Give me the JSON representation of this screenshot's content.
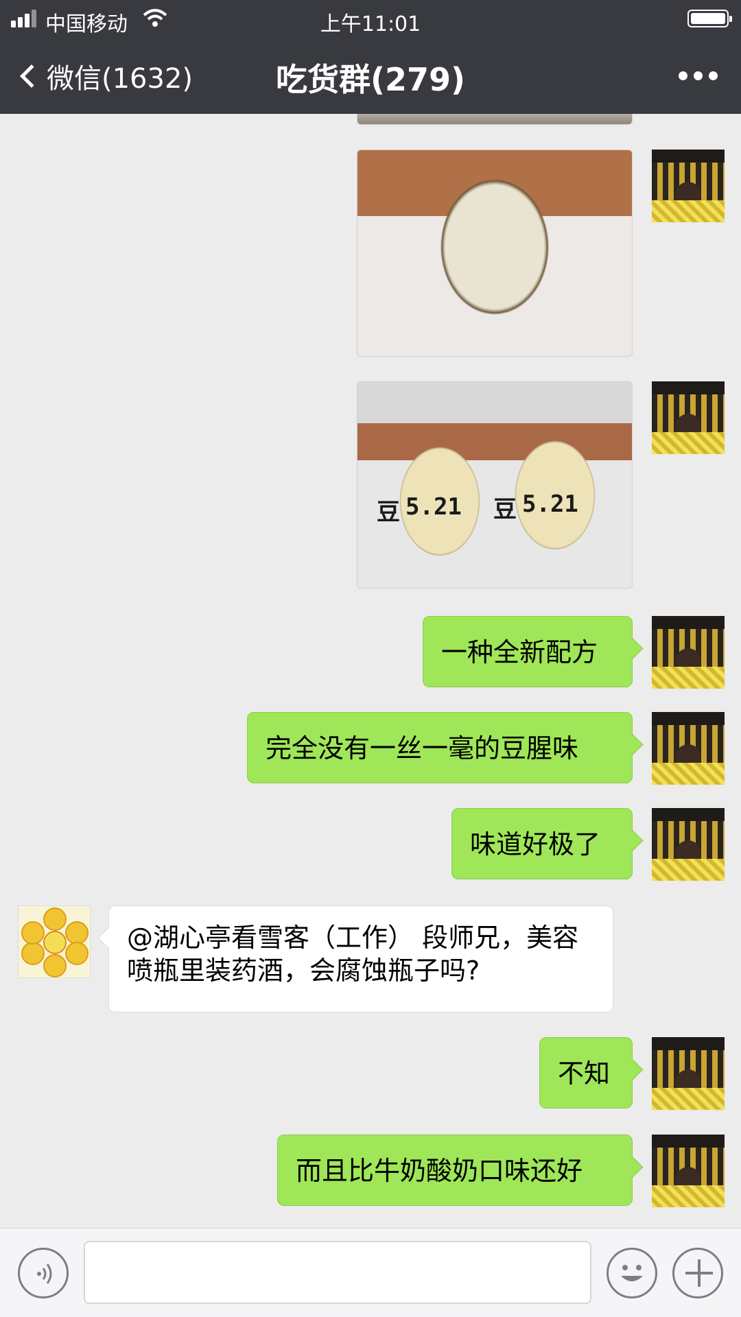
{
  "status_bar": {
    "carrier": "中国移动",
    "time": "上午11:01"
  },
  "nav": {
    "back_label": "微信(1632)",
    "title": "吃货群(279)"
  },
  "messages": [
    {
      "side": "me",
      "type": "image",
      "description_icon": "photo"
    },
    {
      "side": "me",
      "type": "image",
      "jar_labels": [
        "豆",
        "5.21"
      ]
    },
    {
      "side": "me",
      "type": "text",
      "text": "一种全新配方"
    },
    {
      "side": "me",
      "type": "text",
      "text": "完全没有一丝一毫的豆腥味"
    },
    {
      "side": "me",
      "type": "text",
      "text": "味道好极了"
    },
    {
      "side": "them",
      "type": "text",
      "text": "@湖心亭看雪客（工作） 段师兄，美容喷瓶里装药酒，会腐蚀瓶子吗?"
    },
    {
      "side": "me",
      "type": "text",
      "text": "不知"
    },
    {
      "side": "me",
      "type": "text",
      "text": "而且比牛奶酸奶口味还好"
    }
  ],
  "colors": {
    "nav_bg": "#393a3f",
    "chat_bg": "#ececec",
    "my_bubble": "#9fe658",
    "their_bubble": "#ffffff"
  },
  "icons": {
    "back": "chevron-left-icon",
    "more": "more-dots-icon",
    "voice": "voice-icon",
    "emoji": "emoji-icon",
    "plus": "plus-icon"
  }
}
